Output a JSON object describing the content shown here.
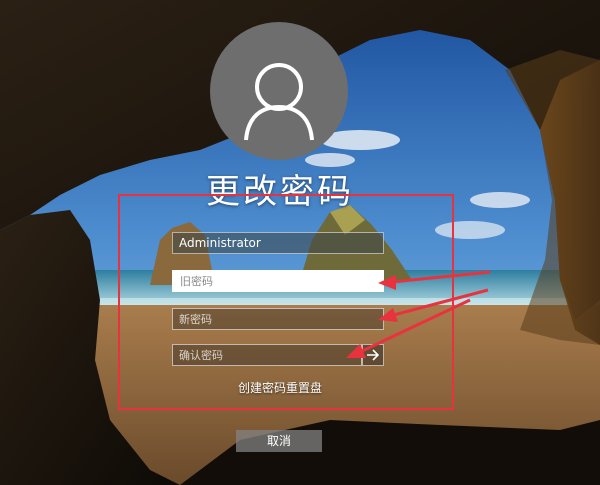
{
  "screen": {
    "title": "更改密码",
    "username": "Administrator"
  },
  "fields": {
    "old_password_placeholder": "旧密码",
    "new_password_placeholder": "新密码",
    "confirm_password_placeholder": "确认密码"
  },
  "actions": {
    "create_reset_disk": "创建密码重置盘",
    "cancel_label": "取消",
    "submit_icon": "arrow-right-icon"
  },
  "icons": {
    "avatar": "user-silhouette-icon"
  },
  "annotation": {
    "color": "#e8333f"
  }
}
